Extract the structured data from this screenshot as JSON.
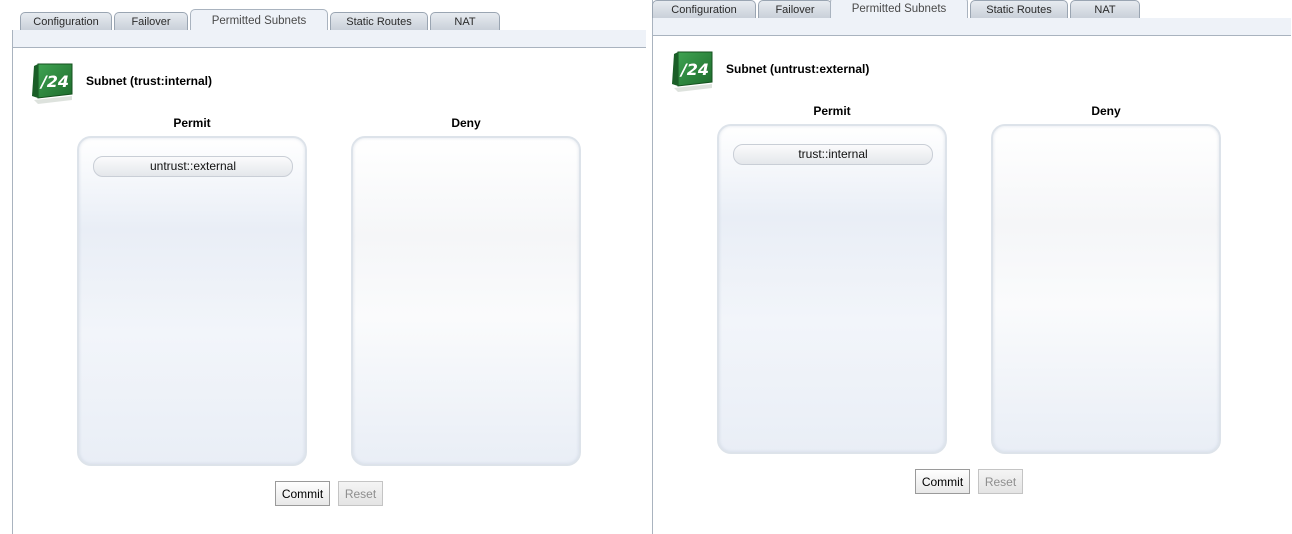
{
  "panels": [
    {
      "tabs": [
        {
          "label": "Configuration",
          "active": false
        },
        {
          "label": "Failover",
          "active": false
        },
        {
          "label": "Permitted Subnets",
          "active": true
        },
        {
          "label": "Static Routes",
          "active": false
        },
        {
          "label": "NAT",
          "active": false
        }
      ],
      "icon_text": "/24",
      "subnet_title": "Subnet (trust:internal)",
      "permit_label": "Permit",
      "deny_label": "Deny",
      "permit_items": [
        "untrust::external"
      ],
      "deny_items": [],
      "commit_label": "Commit",
      "reset_label": "Reset"
    },
    {
      "tabs": [
        {
          "label": "Configuration",
          "active": false
        },
        {
          "label": "Failover",
          "active": false
        },
        {
          "label": "Permitted Subnets",
          "active": true
        },
        {
          "label": "Static Routes",
          "active": false
        },
        {
          "label": "NAT",
          "active": false
        }
      ],
      "icon_text": "/24",
      "subnet_title": "Subnet (untrust:external)",
      "permit_label": "Permit",
      "deny_label": "Deny",
      "permit_items": [
        "trust::internal"
      ],
      "deny_items": [],
      "commit_label": "Commit",
      "reset_label": "Reset"
    }
  ],
  "colors": {
    "icon_green": "#2e8b3e",
    "tab_active_bg": "#eef2f8",
    "tab_border": "#9aa5b2"
  }
}
